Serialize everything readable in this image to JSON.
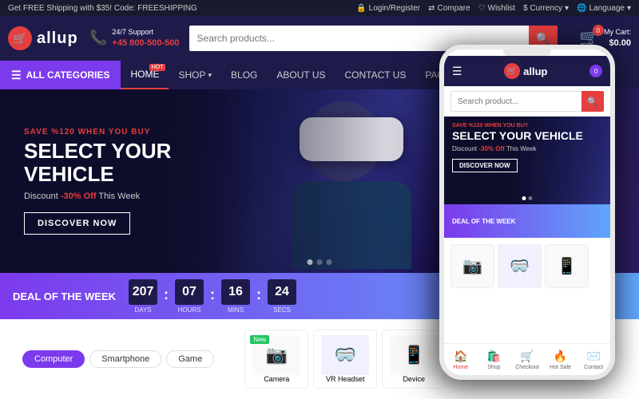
{
  "topbar": {
    "promo": "Get FREE Shipping with $35! Code: FREESHIPPING",
    "login": "Login/Register",
    "compare": "Compare",
    "wishlist": "Wishlist",
    "currency": "$ Currency",
    "language": "Language"
  },
  "header": {
    "logo_text": "allup",
    "support_label": "24/7 Support",
    "support_phone": "+45 800-500-500",
    "search_placeholder": "Search products...",
    "cart_label": "My Cart:",
    "cart_amount": "$0.00",
    "cart_count": "0"
  },
  "nav": {
    "all_categories": "ALL CATEGORIES",
    "links": [
      {
        "label": "HOME",
        "active": true,
        "hot": true,
        "has_dropdown": false
      },
      {
        "label": "SHOP",
        "active": false,
        "hot": false,
        "has_dropdown": true
      },
      {
        "label": "BLOG",
        "active": false,
        "hot": false,
        "has_dropdown": false
      },
      {
        "label": "ABOUT US",
        "active": false,
        "hot": false,
        "has_dropdown": false
      },
      {
        "label": "CONTACT US",
        "active": false,
        "hot": false,
        "has_dropdown": false
      },
      {
        "label": "PAGE",
        "active": false,
        "hot": false,
        "has_dropdown": true
      }
    ]
  },
  "hero": {
    "eyebrow": "SAVE %120 WHEN YOU BUY",
    "title": "SELECT YOUR VEHICLE",
    "discount_prefix": "Discount",
    "discount_amount": "-30% Off",
    "discount_suffix": "This Week",
    "cta_button": "DISCOVER NOW",
    "dots": [
      true,
      false,
      false
    ]
  },
  "deal": {
    "label": "DEAL OF THE WEEK",
    "days_val": "207",
    "days_label": "DAYS",
    "hours_val": "07",
    "hours_label": "HOURS",
    "mins_val": "16",
    "mins_label": "MINS",
    "secs_val": "24",
    "secs_label": "SECS"
  },
  "product_tabs": [
    {
      "label": "Computer",
      "active": true
    },
    {
      "label": "Smartphone",
      "active": false
    },
    {
      "label": "Game",
      "active": false
    }
  ],
  "phone": {
    "logo_text": "allup",
    "search_placeholder": "Search product...",
    "hero_eyebrow": "SAVE %120 WHEN YOU BUY",
    "hero_title": "SELECT YOUR VEHICLE",
    "hero_discount": "Discount",
    "hero_off": "-30% Off",
    "hero_suffix": "This Week",
    "hero_cta": "DISCOVER NOW",
    "deal_label": "DEAL OF THE WEEK",
    "nav_items": [
      {
        "label": "Home",
        "icon": "🏠",
        "active": true
      },
      {
        "label": "Shop",
        "icon": "🛍️",
        "active": false
      },
      {
        "label": "Checkout",
        "icon": "🛒",
        "active": false
      },
      {
        "label": "Hot Sale",
        "icon": "🔥",
        "active": false
      },
      {
        "label": "Contact",
        "icon": "✉️",
        "active": false
      }
    ]
  },
  "products": [
    {
      "name": "Camera",
      "icon": "📷",
      "bg": "#f9f9f9",
      "new": true
    },
    {
      "name": "VR Headset",
      "icon": "🥽",
      "bg": "#f0f0ff",
      "new": false
    },
    {
      "name": "Device",
      "icon": "📱",
      "bg": "#f9f9f9",
      "new": false
    }
  ]
}
